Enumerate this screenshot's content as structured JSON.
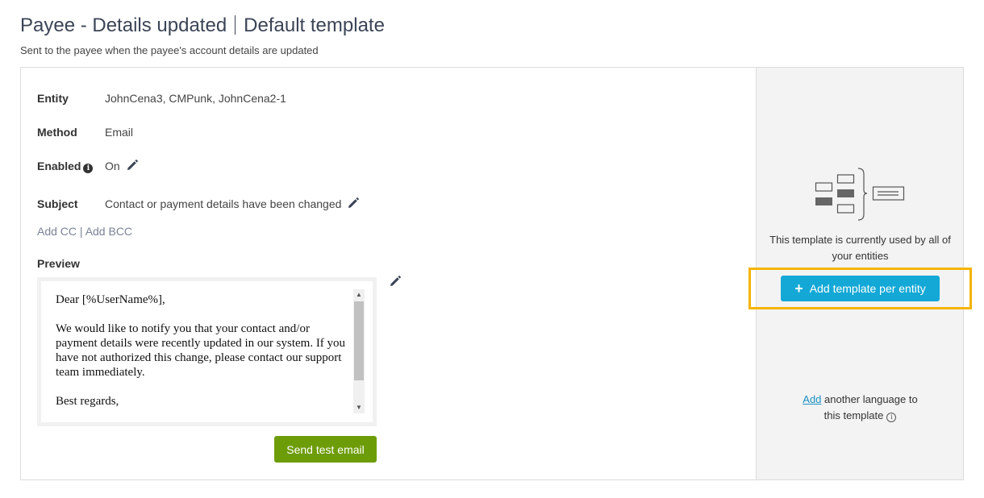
{
  "page": {
    "title": "Payee - Details updated",
    "title_suffix": "Default template",
    "subtitle": "Sent to the payee when the payee's account details are updated"
  },
  "details": {
    "entity_label": "Entity",
    "entity_value": "JohnCena3, CMPunk, JohnCena2-1",
    "method_label": "Method",
    "method_value": "Email",
    "enabled_label": "Enabled",
    "enabled_value": "On",
    "subject_label": "Subject",
    "subject_value": "Contact or payment details have been changed",
    "add_cc": "Add CC",
    "link_separator": " | ",
    "add_bcc": "Add BCC",
    "preview_label": "Preview"
  },
  "preview": {
    "greeting": "Dear [%UserName%],",
    "body": "We would like to notify you that your contact and/or payment details were recently updated in our system. If you have not authorized this change, please contact our support team immediately.",
    "closing": "Best regards,"
  },
  "actions": {
    "send_test_email": "Send test email",
    "add_template_per_entity": "Add template per entity"
  },
  "side": {
    "usage_text": "This template is currently used by all of your entities",
    "add_link": "Add",
    "language_text": " another language to",
    "language_text_2": "this template"
  },
  "colors": {
    "title": "#3b4456",
    "send_button": "#6d9c09",
    "add_button": "#13a8d6",
    "highlight": "#f5b400",
    "side_bg": "#f3f3f4"
  }
}
